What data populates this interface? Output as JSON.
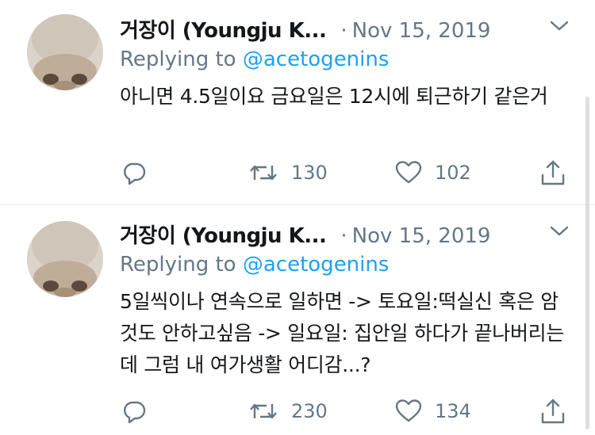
{
  "tweets": [
    {
      "author_name": "거장이 (Youngju K...",
      "separator": "·",
      "date": "Nov 15, 2019",
      "replying_prefix": "Replying to",
      "replying_handle": "@acetogenins",
      "text": "아니면 4.5일이요  금요일은 12시에 퇴근하기 같은거",
      "retweets": "130",
      "likes": "102",
      "icons": {
        "reply": "reply-icon",
        "retweet": "retweet-icon",
        "like": "heart-icon",
        "share": "share-icon",
        "menu": "chevron-down-icon"
      }
    },
    {
      "author_name": "거장이 (Youngju K...",
      "separator": "·",
      "date": "Nov 15, 2019",
      "replying_prefix": "Replying to",
      "replying_handle": "@acetogenins",
      "text": "5일씩이나 연속으로 일하면 -> 토요일:떡실신 혹은 암것도 안하고싶음 -> 일요일:  집안일 하다가 끝나버리는데 그럼 내 여가생활 어디감...?",
      "retweets": "230",
      "likes": "134",
      "icons": {
        "reply": "reply-icon",
        "retweet": "retweet-icon",
        "like": "heart-icon",
        "share": "share-icon",
        "menu": "chevron-down-icon"
      }
    }
  ],
  "colors": {
    "text": "#14171a",
    "secondary": "#657786",
    "link": "#1da1f2",
    "divider": "#e6ecf0"
  }
}
